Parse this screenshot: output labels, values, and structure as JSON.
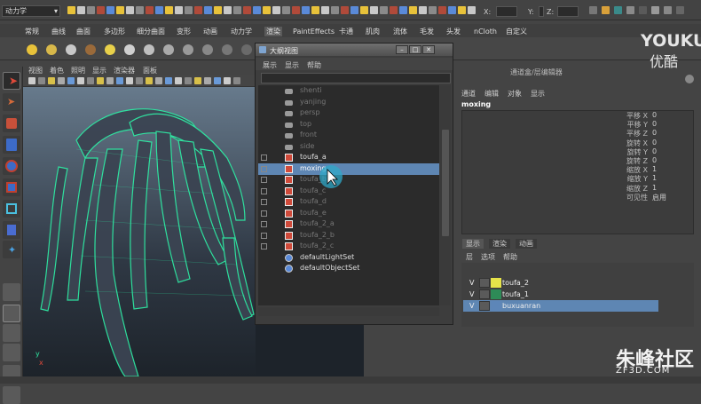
{
  "toolbar": {
    "mode_value": "动力学",
    "x_label": "X:",
    "y_label": "Y:",
    "z_label": "Z:"
  },
  "shelf": {
    "tabs": [
      "常规",
      "曲线",
      "曲面",
      "多边形",
      "细分曲面",
      "变形",
      "动画",
      "动力学",
      "渲染",
      "PaintEffects",
      "卡通",
      "肌肉",
      "流体",
      "毛发",
      "头发",
      "nCloth",
      "自定义"
    ],
    "active_tab_index": 8
  },
  "viewport": {
    "menu": [
      "视图",
      "着色",
      "照明",
      "显示",
      "渲染器",
      "面板"
    ]
  },
  "outliner": {
    "title": "大纲视图",
    "menu": [
      "展示",
      "显示",
      "帮助"
    ],
    "items": [
      {
        "label": "shenti",
        "icon": "camera-icon",
        "expand": false,
        "selected": false,
        "dim": true
      },
      {
        "label": "yanjing",
        "icon": "camera-icon",
        "expand": false,
        "selected": false,
        "dim": true
      },
      {
        "label": "persp",
        "icon": "camera-icon",
        "expand": false,
        "selected": false,
        "dim": true
      },
      {
        "label": "top",
        "icon": "camera-icon",
        "expand": false,
        "selected": false,
        "dim": true
      },
      {
        "label": "front",
        "icon": "camera-icon",
        "expand": false,
        "selected": false,
        "dim": true
      },
      {
        "label": "side",
        "icon": "camera-icon",
        "expand": false,
        "selected": false,
        "dim": true
      },
      {
        "label": "toufa_a",
        "icon": "mesh-icon",
        "expand": true,
        "selected": false,
        "dim": false
      },
      {
        "label": "moxing",
        "icon": "mesh-icon",
        "expand": true,
        "selected": true,
        "dim": false
      },
      {
        "label": "toufa_b",
        "icon": "mesh-icon",
        "expand": true,
        "selected": false,
        "dim": true
      },
      {
        "label": "toufa_c",
        "icon": "mesh-icon",
        "expand": true,
        "selected": false,
        "dim": true
      },
      {
        "label": "toufa_d",
        "icon": "mesh-icon",
        "expand": true,
        "selected": false,
        "dim": true
      },
      {
        "label": "toufa_e",
        "icon": "mesh-icon",
        "expand": true,
        "selected": false,
        "dim": true
      },
      {
        "label": "toufa_2_a",
        "icon": "mesh-icon",
        "expand": true,
        "selected": false,
        "dim": true
      },
      {
        "label": "toufa_2_b",
        "icon": "mesh-icon",
        "expand": true,
        "selected": false,
        "dim": true
      },
      {
        "label": "toufa_2_c",
        "icon": "mesh-icon",
        "expand": true,
        "selected": false,
        "dim": true
      },
      {
        "label": "defaultLightSet",
        "icon": "set-icon",
        "expand": false,
        "selected": false,
        "dim": false
      },
      {
        "label": "defaultObjectSet",
        "icon": "set-icon",
        "expand": false,
        "selected": false,
        "dim": false
      }
    ]
  },
  "channel_box": {
    "title": "通道盒/层编辑器",
    "menu": [
      "通道",
      "编辑",
      "对象",
      "显示"
    ],
    "node_name": "moxing",
    "attributes": [
      {
        "name": "平移 X",
        "value": "0"
      },
      {
        "name": "平移 Y",
        "value": "0"
      },
      {
        "name": "平移 Z",
        "value": "0"
      },
      {
        "name": "旋转 X",
        "value": "0"
      },
      {
        "name": "旋转 Y",
        "value": "0"
      },
      {
        "name": "旋转 Z",
        "value": "0"
      },
      {
        "name": "缩放 X",
        "value": "1"
      },
      {
        "name": "缩放 Y",
        "value": "1"
      },
      {
        "name": "缩放 Z",
        "value": "1"
      },
      {
        "name": "可见性",
        "value": "启用"
      }
    ]
  },
  "layer_editor": {
    "tabs": [
      "显示",
      "渲染",
      "动画"
    ],
    "menu": [
      "层",
      "选项",
      "帮助"
    ],
    "layers": [
      {
        "v": "V",
        "name": "toufa_2",
        "color": "#e6e34a",
        "selected": false
      },
      {
        "v": "V",
        "name": "toufa_1",
        "color": "#2e8b57",
        "selected": false
      },
      {
        "v": "V",
        "name": "buxuanran",
        "color": "#5d86b8",
        "selected": true
      }
    ]
  },
  "watermarks": {
    "youku": "YOUKU",
    "youku_cn": "优酷",
    "site_cn": "朱峰社区",
    "site_en": "ZF3D.COM"
  },
  "colors": {
    "selection": "#5e86b3",
    "wire_green": "#2ee8a2",
    "panel_bg": "#444444"
  }
}
